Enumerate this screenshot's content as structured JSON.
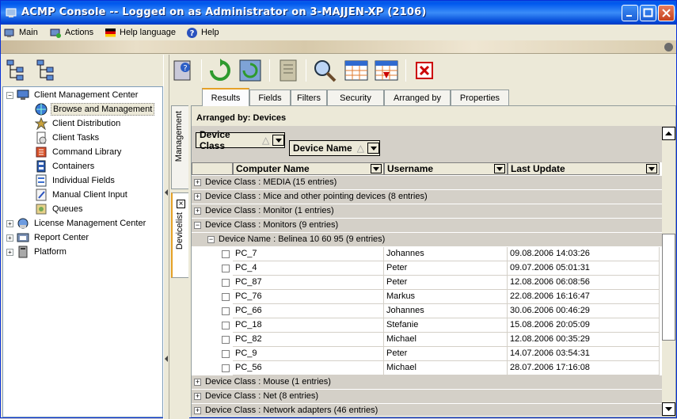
{
  "window": {
    "title": "ACMP Console -- Logged on as Administrator on 3-MAJJEN-XP (2106)"
  },
  "menu": {
    "items": [
      {
        "label": "Main",
        "icon": "main-icon"
      },
      {
        "label": "Actions",
        "icon": "actions-icon"
      },
      {
        "label": "Help language",
        "icon": "flag-icon"
      },
      {
        "label": "Help",
        "icon": "help-icon"
      }
    ]
  },
  "tree": {
    "items": [
      {
        "label": "Client Management Center",
        "expander": "−"
      },
      {
        "label": "Browse and Management"
      },
      {
        "label": "Client Distribution"
      },
      {
        "label": "Client Tasks"
      },
      {
        "label": "Command Library"
      },
      {
        "label": "Containers"
      },
      {
        "label": "Individual Fields"
      },
      {
        "label": "Manual Client Input"
      },
      {
        "label": "Queues"
      },
      {
        "label": "License Management Center",
        "expander": "+"
      },
      {
        "label": "Report Center",
        "expander": "+"
      },
      {
        "label": "Platform",
        "expander": "+"
      }
    ]
  },
  "vtabs": {
    "management": "Management",
    "devicelist": "Devicelist",
    "close": "×"
  },
  "tabs": [
    "Results",
    "Fields",
    "Filters",
    "Security",
    "Arranged by",
    "Properties"
  ],
  "content": {
    "arranged_label": "Arranged by: Devices",
    "group_boxes": [
      {
        "label": "Device Class",
        "sort": "△"
      },
      {
        "label": "Device Name",
        "sort": "△"
      }
    ],
    "columns": [
      "Computer Name",
      "Username",
      "Last Update"
    ],
    "groups_top": [
      {
        "exp": "+",
        "text": "Device Class : MEDIA (15 entries)"
      },
      {
        "exp": "+",
        "text": "Device Class : Mice and other pointing devices (8 entries)"
      },
      {
        "exp": "+",
        "text": "Device Class : Monitor (1 entries)"
      },
      {
        "exp": "−",
        "text": "Device Class : Monitors (9 entries)"
      }
    ],
    "subgroup": {
      "exp": "−",
      "text": "Device Name : Belinea 10 60 95 (9 entries)"
    },
    "rows": [
      {
        "computer": "PC_7",
        "user": "Johannes",
        "updated": "09.08.2006 14:03:26"
      },
      {
        "computer": "PC_4",
        "user": "Peter",
        "updated": "09.07.2006 05:01:31"
      },
      {
        "computer": "PC_87",
        "user": "Peter",
        "updated": "12.08.2006 06:08:56"
      },
      {
        "computer": "PC_76",
        "user": "Markus",
        "updated": "22.08.2006 16:16:47"
      },
      {
        "computer": "PC_66",
        "user": "Johannes",
        "updated": "30.06.2006 00:46:29"
      },
      {
        "computer": "PC_18",
        "user": "Stefanie",
        "updated": "15.08.2006 20:05:09"
      },
      {
        "computer": "PC_82",
        "user": "Michael",
        "updated": "12.08.2006 00:35:29"
      },
      {
        "computer": "PC_9",
        "user": "Peter",
        "updated": "14.07.2006 03:54:31"
      },
      {
        "computer": "PC_56",
        "user": "Michael",
        "updated": "28.07.2006 17:16:08"
      }
    ],
    "groups_bottom": [
      {
        "exp": "+",
        "text": "Device Class : Mouse (1 entries)"
      },
      {
        "exp": "+",
        "text": "Device Class : Net (8 entries)"
      },
      {
        "exp": "+",
        "text": "Device Class : Network adapters (46 entries)"
      }
    ]
  }
}
